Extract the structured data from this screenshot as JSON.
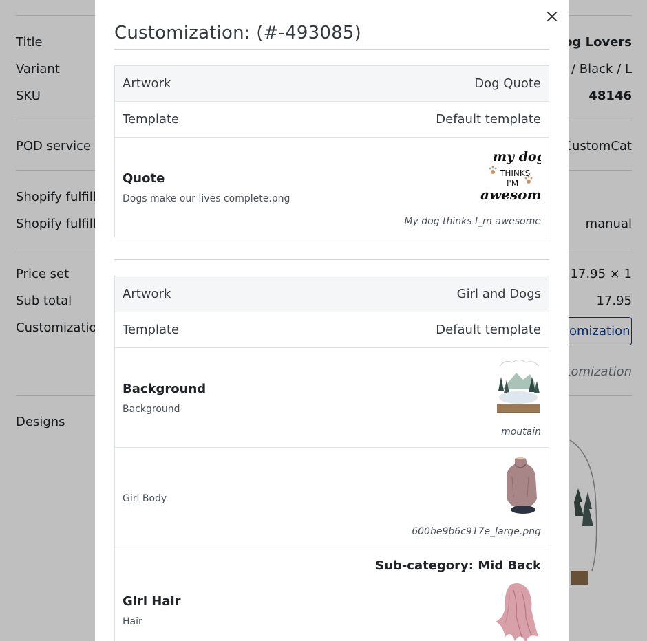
{
  "background": {
    "title_label": "Title",
    "title_value": "Dog Lovers",
    "variant_label": "Variant",
    "variant_value": "t / Black / L",
    "sku_label": "SKU",
    "sku_value": "48146",
    "pod_label": "POD service",
    "pod_value": "CustomCat",
    "shopify_label_1": "Shopify fulfillm",
    "shopify_label_2": "Shopify fulfillm",
    "shopify_value_2": "manual",
    "price_label": "Price set",
    "price_value": "17.95 × 1",
    "subtotal_label": "Sub total",
    "subtotal_value": "17.95",
    "customization_label": "Customization",
    "customization_button": "omization",
    "customization_note": "stomization",
    "designs_label": "Designs"
  },
  "modal": {
    "title": "Customization: (#-493085)",
    "close_icon": "close-icon",
    "sections": [
      {
        "artwork_label": "Artwork",
        "artwork_value": "Dog Quote",
        "template_label": "Template",
        "template_value": "Default template",
        "layers": [
          {
            "name": "Quote",
            "subtitle": "Dogs make our lives complete.png",
            "caption": "My dog thinks I_m awesome",
            "image_text_1": "my dog",
            "image_text_2": "THINKS",
            "image_text_3": "I'M",
            "image_text_4": "awesome"
          }
        ]
      },
      {
        "artwork_label": "Artwork",
        "artwork_value": "Girl and Dogs",
        "template_label": "Template",
        "template_value": "Default template",
        "layers": [
          {
            "name": "Background",
            "subtitle": "Background",
            "caption": "moutain"
          },
          {
            "name": "",
            "subtitle": "Girl Body",
            "caption": "600be9b6c917e_large.png"
          },
          {
            "name": "Girl Hair",
            "subtitle": "Hair",
            "subcategory": "Sub-category: Mid Back",
            "caption": ""
          }
        ]
      }
    ]
  }
}
